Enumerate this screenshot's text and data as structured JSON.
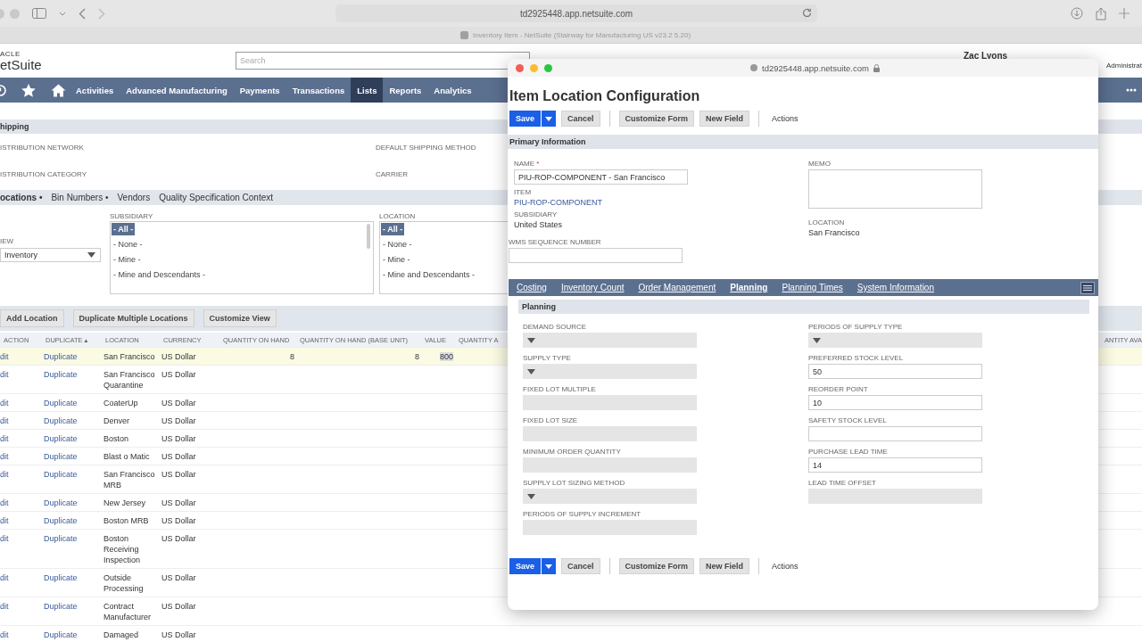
{
  "browser": {
    "url": "td2925448.app.netsuite.com",
    "tab_title": "Inventory Item - NetSuite (Stairway for Manufacturing US v23.2 5.20)"
  },
  "header": {
    "logo_top": "ACLE",
    "logo_main": "etSuite",
    "search_placeholder": "Search",
    "user_name": "Zac Lyons",
    "user_role": "Administrat"
  },
  "nav": [
    {
      "label": "Activities",
      "selected": false
    },
    {
      "label": "Advanced Manufacturing",
      "selected": false
    },
    {
      "label": "Payments",
      "selected": false
    },
    {
      "label": "Transactions",
      "selected": false
    },
    {
      "label": "Lists",
      "selected": true
    },
    {
      "label": "Reports",
      "selected": false
    },
    {
      "label": "Analytics",
      "selected": false
    }
  ],
  "shipping": {
    "title": "hipping",
    "fields": [
      {
        "left": "ISTRIBUTION NETWORK",
        "right": "DEFAULT SHIPPING METHOD"
      },
      {
        "left": "ISTRIBUTION CATEGORY",
        "right": "CARRIER"
      }
    ]
  },
  "subtabs": [
    {
      "label": "ocations •",
      "selected": true
    },
    {
      "label": "Bin Numbers •",
      "selected": false
    },
    {
      "label": "Vendors",
      "selected": false
    },
    {
      "label": "Quality Specification Context",
      "selected": false
    }
  ],
  "filters": {
    "view_label": "IEW",
    "view_value": "Inventory",
    "subsidiary_label": "SUBSIDIARY",
    "subsidiary_options": [
      {
        "label": "- All -",
        "selected": true
      },
      {
        "label": "- None -",
        "selected": false
      },
      {
        "label": "- Mine -",
        "selected": false
      },
      {
        "label": "- Mine and Descendants -",
        "selected": false
      }
    ],
    "location_label": "LOCATION",
    "location_options": [
      {
        "label": "- All -",
        "selected": true
      },
      {
        "label": "- None -",
        "selected": false
      },
      {
        "label": "- Mine -",
        "selected": false
      },
      {
        "label": "- Mine and Descendants -",
        "selected": false
      }
    ]
  },
  "list_buttons": [
    "Add Location",
    "Duplicate Multiple Locations",
    "Customize View"
  ],
  "table": {
    "columns": [
      "ACTION",
      "DUPLICATE ▴",
      "LOCATION",
      "CURRENCY",
      "QUANTITY ON HAND",
      "QUANTITY ON HAND (BASE UNIT)",
      "VALUE",
      "QUANTITY A"
    ],
    "right_column": "ANTITY AVA",
    "rows": [
      {
        "action": "dit",
        "duplicate": "Duplicate",
        "location": "San Francisco",
        "currency": "US Dollar",
        "qty": "8",
        "qty_base": "8",
        "value": "800",
        "selected": true
      },
      {
        "action": "dit",
        "duplicate": "Duplicate",
        "location": "San Francisco Quarantine",
        "currency": "US Dollar",
        "selected": false
      },
      {
        "action": "dit",
        "duplicate": "Duplicate",
        "location": "CoaterUp",
        "currency": "US Dollar",
        "selected": false
      },
      {
        "action": "dit",
        "duplicate": "Duplicate",
        "location": "Denver",
        "currency": "US Dollar",
        "selected": false
      },
      {
        "action": "dit",
        "duplicate": "Duplicate",
        "location": "Boston",
        "currency": "US Dollar",
        "selected": false
      },
      {
        "action": "dit",
        "duplicate": "Duplicate",
        "location": "Blast o Matic",
        "currency": "US Dollar",
        "selected": false
      },
      {
        "action": "dit",
        "duplicate": "Duplicate",
        "location": "San Francisco MRB",
        "currency": "US Dollar",
        "selected": false
      },
      {
        "action": "dit",
        "duplicate": "Duplicate",
        "location": "New Jersey",
        "currency": "US Dollar",
        "selected": false
      },
      {
        "action": "dit",
        "duplicate": "Duplicate",
        "location": "Boston MRB",
        "currency": "US Dollar",
        "selected": false
      },
      {
        "action": "dit",
        "duplicate": "Duplicate",
        "location": "Boston Receiving Inspection",
        "currency": "US Dollar",
        "selected": false
      },
      {
        "action": "dit",
        "duplicate": "Duplicate",
        "location": "Outside Processing",
        "currency": "US Dollar",
        "selected": false
      },
      {
        "action": "dit",
        "duplicate": "Duplicate",
        "location": "Contract Manufacturer",
        "currency": "US Dollar",
        "selected": false
      },
      {
        "action": "dit",
        "duplicate": "Duplicate",
        "location": "Damaged",
        "currency": "US Dollar",
        "selected": false
      }
    ]
  },
  "popup": {
    "url": "td2925448.app.netsuite.com",
    "title": "Item Location Configuration",
    "buttons": {
      "save": "Save",
      "cancel": "Cancel",
      "customize": "Customize Form",
      "new_field": "New Field",
      "actions": "Actions"
    },
    "bottom_buttons": {
      "save": "Save",
      "cancel": "Cancel",
      "customize": "Customize Form",
      "new_field": "New Field",
      "actions": "Actions"
    },
    "primary_title": "Primary Information",
    "name_label": "NAME",
    "required_mark": "*",
    "name_value": "PIU-ROP-COMPONENT - San Francisco",
    "item_label": "ITEM",
    "item_value": "PIU-ROP-COMPONENT",
    "subsidiary_label": "SUBSIDIARY",
    "subsidiary_value": "United States",
    "wms_label": "WMS SEQUENCE NUMBER",
    "memo_label": "MEMO",
    "location_label": "LOCATION",
    "location_value": "San Francisco",
    "tabs": [
      {
        "label": "Costing",
        "selected": false
      },
      {
        "label": "Inventory Count",
        "selected": false
      },
      {
        "label": "Order Management",
        "selected": false
      },
      {
        "label": "Planning",
        "selected": true
      },
      {
        "label": "Planning Times",
        "selected": false
      },
      {
        "label": "System Information",
        "selected": false
      }
    ],
    "planning_title": "Planning",
    "left_fields": [
      {
        "label": "DEMAND SOURCE",
        "kind": "select",
        "disabled": true
      },
      {
        "label": "SUPPLY TYPE",
        "kind": "select",
        "disabled": true
      },
      {
        "label": "FIXED LOT MULTIPLE",
        "kind": "text",
        "disabled": true
      },
      {
        "label": "FIXED LOT SIZE",
        "kind": "text",
        "disabled": true
      },
      {
        "label": "MINIMUM ORDER QUANTITY",
        "kind": "text",
        "disabled": true
      },
      {
        "label": "SUPPLY LOT SIZING METHOD",
        "kind": "select",
        "disabled": true
      },
      {
        "label": "PERIODS OF SUPPLY INCREMENT",
        "kind": "text",
        "disabled": true
      }
    ],
    "right_fields": [
      {
        "label": "PERIODS OF SUPPLY TYPE",
        "kind": "select",
        "disabled": true
      },
      {
        "label": "PREFERRED STOCK LEVEL",
        "kind": "text",
        "disabled": false,
        "value": "50"
      },
      {
        "label": "REORDER POINT",
        "kind": "text",
        "disabled": false,
        "value": "10"
      },
      {
        "label": "SAFETY STOCK LEVEL",
        "kind": "text",
        "disabled": false
      },
      {
        "label": "PURCHASE LEAD TIME",
        "kind": "text",
        "disabled": false,
        "value": "14"
      },
      {
        "label": "LEAD TIME OFFSET",
        "kind": "text",
        "disabled": true
      }
    ]
  }
}
